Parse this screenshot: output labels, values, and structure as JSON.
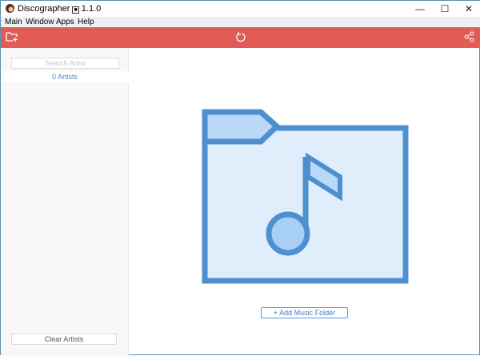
{
  "window": {
    "title": "Discographer",
    "version": "1.1.0",
    "minimize": "—",
    "maximize": "☐",
    "close": "✕"
  },
  "menu": [
    "Main",
    "Window",
    "Apps",
    "Help"
  ],
  "sidebar": {
    "search_placeholder": "Search Artist",
    "artist_count": "0 Artists",
    "clear_label": "Clear Artists"
  },
  "main": {
    "add_folder_label": "+ Add Music Folder"
  },
  "colors": {
    "accent": "#e05c55",
    "link": "#3a8fd8",
    "illustration": "#4e8fd0"
  }
}
